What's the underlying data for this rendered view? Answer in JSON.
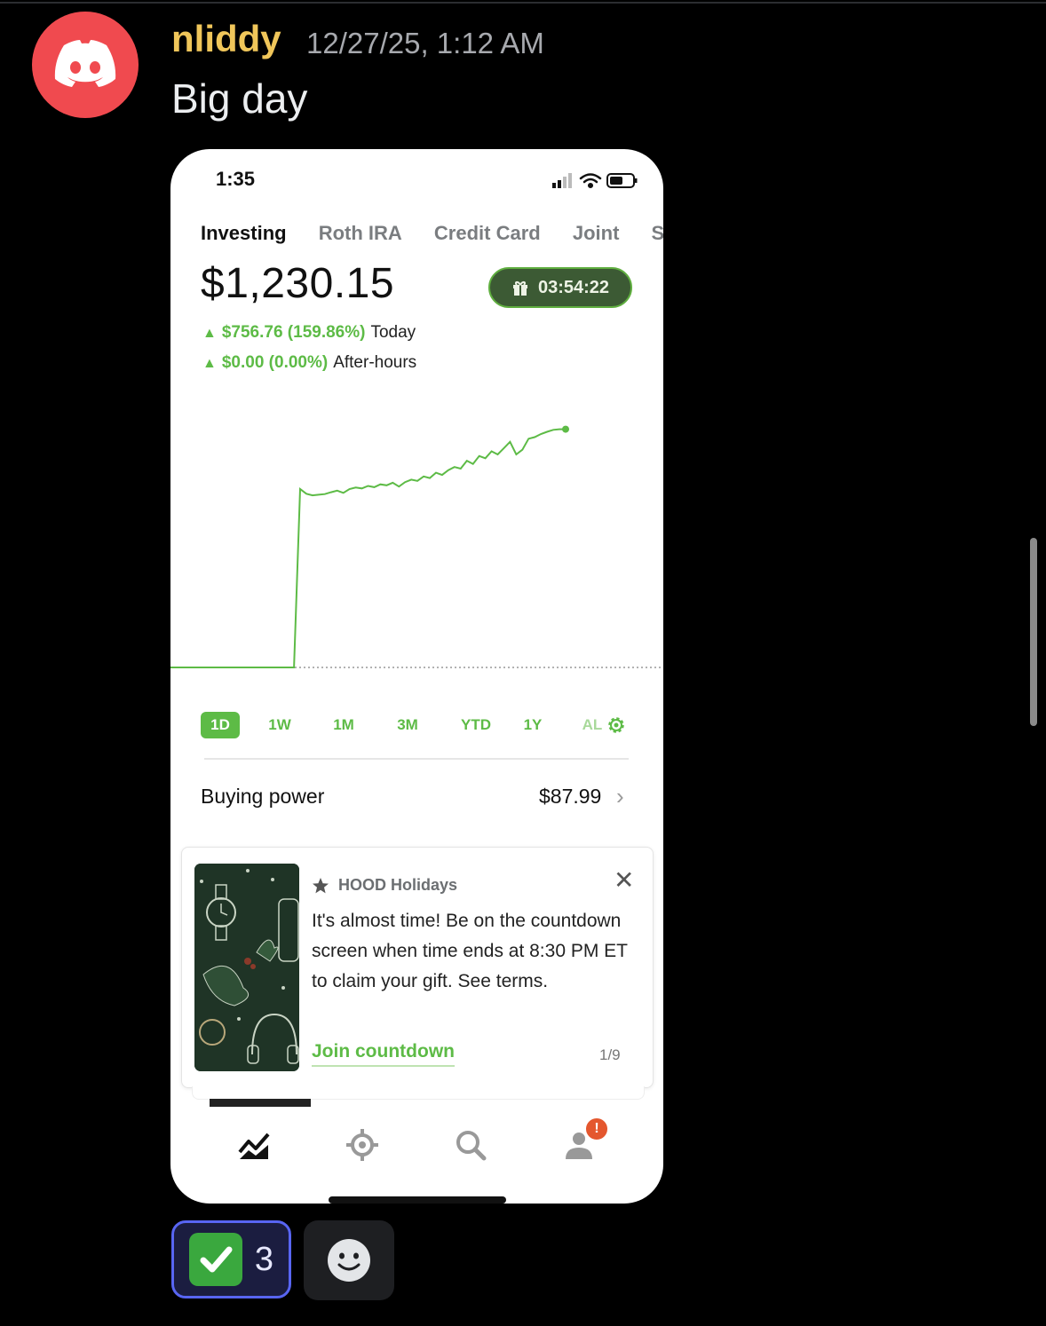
{
  "message": {
    "username": "nliddy",
    "timestamp": "12/27/25, 1:12 AM",
    "text": "Big day",
    "avatar_icon": "discord-logo-icon",
    "avatar_color": "#f04a4f",
    "username_color": "#f0c65a"
  },
  "screenshot": {
    "status_time": "1:35",
    "account_tabs": [
      "Investing",
      "Roth IRA",
      "Credit Card",
      "Joint",
      "St"
    ],
    "active_tab": "Investing",
    "balance": "$1,230.15",
    "countdown": "03:54:22",
    "today_change": {
      "value": "$756.76 (159.86%)",
      "label": "Today"
    },
    "after_hours_change": {
      "value": "$0.00 (0.00%)",
      "label": "After-hours"
    },
    "accent_color": "#5dbb46",
    "ranges": [
      "1D",
      "1W",
      "1M",
      "3M",
      "YTD",
      "1Y",
      "AL"
    ],
    "active_range": "1D",
    "buying_power": {
      "label": "Buying power",
      "value": "$87.99"
    },
    "promo_card": {
      "title": "HOOD Holidays",
      "body": "It's almost time! Be on the countdown screen when time ends at 8:30 PM ET to claim your gift. See terms.",
      "link": "Join countdown",
      "page": "1/9"
    },
    "nav_icons": [
      "chart-icon",
      "crypto-icon",
      "search-icon",
      "profile-icon"
    ],
    "notification_badge": "!"
  },
  "reactions": [
    {
      "emoji": "white-check-mark-icon",
      "count": "3"
    }
  ],
  "add_reaction_icon": "smiley-icon",
  "chart_data": {
    "type": "line",
    "title": "",
    "xlabel": "",
    "ylabel": "",
    "baseline": "flat then jump",
    "values": [
      473.39,
      473.39,
      473.39,
      473.39,
      473.39,
      473.39,
      473.39,
      473.39,
      473.39,
      473.39,
      473.39,
      473.39,
      473.39,
      473.39,
      473.39,
      473.39,
      473.39,
      473.39,
      473.39,
      473.39,
      473.39,
      1040,
      1025,
      1020,
      1022,
      1024,
      1030,
      1035,
      1028,
      1040,
      1045,
      1042,
      1050,
      1046,
      1055,
      1052,
      1060,
      1048,
      1062,
      1070,
      1066,
      1080,
      1075,
      1092,
      1085,
      1100,
      1110,
      1105,
      1130,
      1120,
      1145,
      1138,
      1160,
      1150,
      1170,
      1190,
      1150,
      1165,
      1200,
      1205,
      1215,
      1222,
      1228,
      1230,
      1230.15
    ]
  }
}
